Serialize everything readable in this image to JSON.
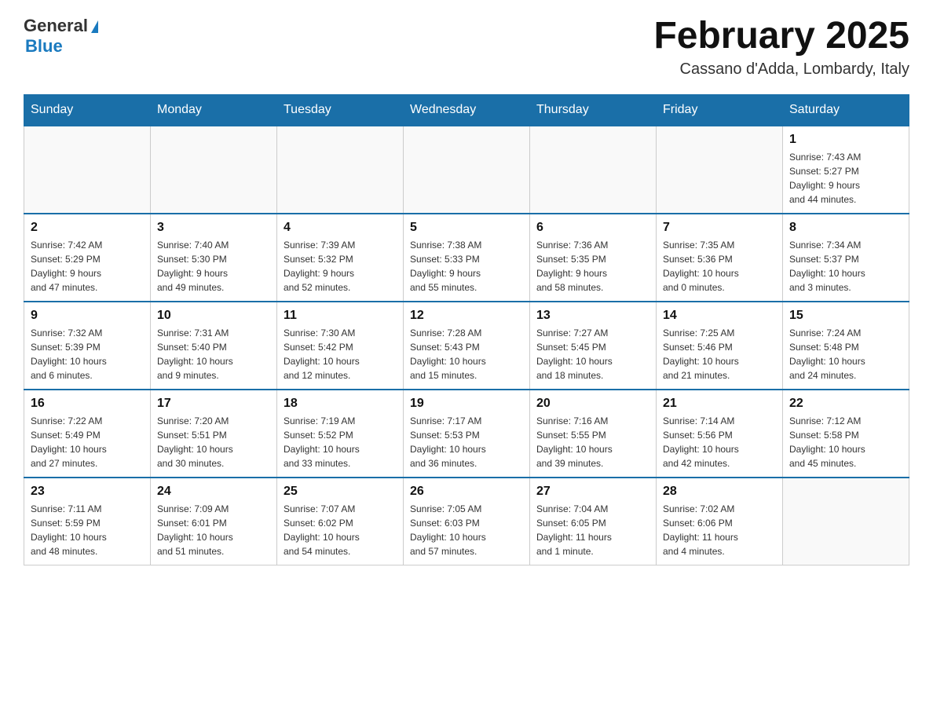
{
  "header": {
    "logo": {
      "general": "General",
      "blue": "Blue"
    },
    "title": "February 2025",
    "location": "Cassano d'Adda, Lombardy, Italy"
  },
  "days_of_week": [
    "Sunday",
    "Monday",
    "Tuesday",
    "Wednesday",
    "Thursday",
    "Friday",
    "Saturday"
  ],
  "weeks": [
    {
      "days": [
        {
          "number": "",
          "info": ""
        },
        {
          "number": "",
          "info": ""
        },
        {
          "number": "",
          "info": ""
        },
        {
          "number": "",
          "info": ""
        },
        {
          "number": "",
          "info": ""
        },
        {
          "number": "",
          "info": ""
        },
        {
          "number": "1",
          "info": "Sunrise: 7:43 AM\nSunset: 5:27 PM\nDaylight: 9 hours\nand 44 minutes."
        }
      ]
    },
    {
      "days": [
        {
          "number": "2",
          "info": "Sunrise: 7:42 AM\nSunset: 5:29 PM\nDaylight: 9 hours\nand 47 minutes."
        },
        {
          "number": "3",
          "info": "Sunrise: 7:40 AM\nSunset: 5:30 PM\nDaylight: 9 hours\nand 49 minutes."
        },
        {
          "number": "4",
          "info": "Sunrise: 7:39 AM\nSunset: 5:32 PM\nDaylight: 9 hours\nand 52 minutes."
        },
        {
          "number": "5",
          "info": "Sunrise: 7:38 AM\nSunset: 5:33 PM\nDaylight: 9 hours\nand 55 minutes."
        },
        {
          "number": "6",
          "info": "Sunrise: 7:36 AM\nSunset: 5:35 PM\nDaylight: 9 hours\nand 58 minutes."
        },
        {
          "number": "7",
          "info": "Sunrise: 7:35 AM\nSunset: 5:36 PM\nDaylight: 10 hours\nand 0 minutes."
        },
        {
          "number": "8",
          "info": "Sunrise: 7:34 AM\nSunset: 5:37 PM\nDaylight: 10 hours\nand 3 minutes."
        }
      ]
    },
    {
      "days": [
        {
          "number": "9",
          "info": "Sunrise: 7:32 AM\nSunset: 5:39 PM\nDaylight: 10 hours\nand 6 minutes."
        },
        {
          "number": "10",
          "info": "Sunrise: 7:31 AM\nSunset: 5:40 PM\nDaylight: 10 hours\nand 9 minutes."
        },
        {
          "number": "11",
          "info": "Sunrise: 7:30 AM\nSunset: 5:42 PM\nDaylight: 10 hours\nand 12 minutes."
        },
        {
          "number": "12",
          "info": "Sunrise: 7:28 AM\nSunset: 5:43 PM\nDaylight: 10 hours\nand 15 minutes."
        },
        {
          "number": "13",
          "info": "Sunrise: 7:27 AM\nSunset: 5:45 PM\nDaylight: 10 hours\nand 18 minutes."
        },
        {
          "number": "14",
          "info": "Sunrise: 7:25 AM\nSunset: 5:46 PM\nDaylight: 10 hours\nand 21 minutes."
        },
        {
          "number": "15",
          "info": "Sunrise: 7:24 AM\nSunset: 5:48 PM\nDaylight: 10 hours\nand 24 minutes."
        }
      ]
    },
    {
      "days": [
        {
          "number": "16",
          "info": "Sunrise: 7:22 AM\nSunset: 5:49 PM\nDaylight: 10 hours\nand 27 minutes."
        },
        {
          "number": "17",
          "info": "Sunrise: 7:20 AM\nSunset: 5:51 PM\nDaylight: 10 hours\nand 30 minutes."
        },
        {
          "number": "18",
          "info": "Sunrise: 7:19 AM\nSunset: 5:52 PM\nDaylight: 10 hours\nand 33 minutes."
        },
        {
          "number": "19",
          "info": "Sunrise: 7:17 AM\nSunset: 5:53 PM\nDaylight: 10 hours\nand 36 minutes."
        },
        {
          "number": "20",
          "info": "Sunrise: 7:16 AM\nSunset: 5:55 PM\nDaylight: 10 hours\nand 39 minutes."
        },
        {
          "number": "21",
          "info": "Sunrise: 7:14 AM\nSunset: 5:56 PM\nDaylight: 10 hours\nand 42 minutes."
        },
        {
          "number": "22",
          "info": "Sunrise: 7:12 AM\nSunset: 5:58 PM\nDaylight: 10 hours\nand 45 minutes."
        }
      ]
    },
    {
      "days": [
        {
          "number": "23",
          "info": "Sunrise: 7:11 AM\nSunset: 5:59 PM\nDaylight: 10 hours\nand 48 minutes."
        },
        {
          "number": "24",
          "info": "Sunrise: 7:09 AM\nSunset: 6:01 PM\nDaylight: 10 hours\nand 51 minutes."
        },
        {
          "number": "25",
          "info": "Sunrise: 7:07 AM\nSunset: 6:02 PM\nDaylight: 10 hours\nand 54 minutes."
        },
        {
          "number": "26",
          "info": "Sunrise: 7:05 AM\nSunset: 6:03 PM\nDaylight: 10 hours\nand 57 minutes."
        },
        {
          "number": "27",
          "info": "Sunrise: 7:04 AM\nSunset: 6:05 PM\nDaylight: 11 hours\nand 1 minute."
        },
        {
          "number": "28",
          "info": "Sunrise: 7:02 AM\nSunset: 6:06 PM\nDaylight: 11 hours\nand 4 minutes."
        },
        {
          "number": "",
          "info": ""
        }
      ]
    }
  ]
}
